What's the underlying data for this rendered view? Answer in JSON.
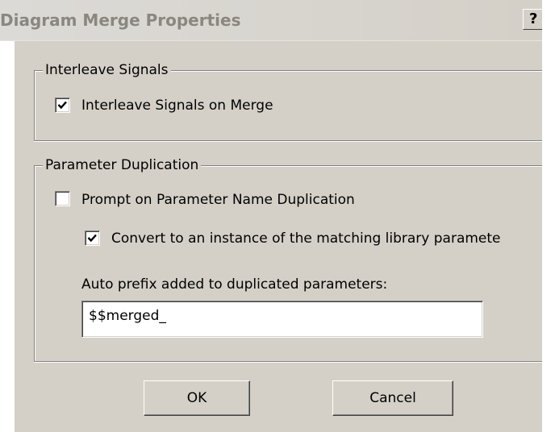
{
  "window": {
    "title": "Diagram Merge Properties",
    "help_label": "?"
  },
  "interleave_group": {
    "legend": "Interleave Signals",
    "checkbox_label": "Interleave Signals on Merge",
    "checked": true
  },
  "parameter_group": {
    "legend": "Parameter Duplication",
    "prompt_label": "Prompt on Parameter Name Duplication",
    "prompt_checked": false,
    "convert_label": "Convert to an instance of the matching library paramete",
    "convert_checked": true,
    "prefix_label": "Auto prefix added to duplicated parameters:",
    "prefix_value": "$$merged_"
  },
  "buttons": {
    "ok_label": "OK",
    "cancel_label": "Cancel"
  },
  "colors": {
    "face": "#d4d0c8",
    "title_text": "#8a8780"
  }
}
